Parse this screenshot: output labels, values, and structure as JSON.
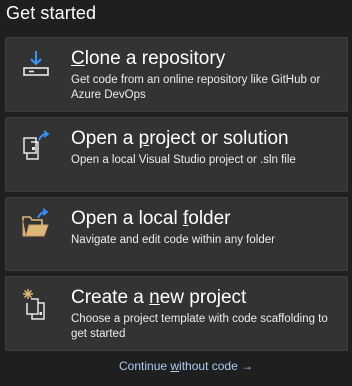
{
  "heading": "Get started",
  "cards": [
    {
      "icon": "clone-repository-icon",
      "title_pre": "",
      "title_key": "C",
      "title_post": "lone a repository",
      "description": "Get code from an online repository like GitHub or Azure DevOps"
    },
    {
      "icon": "open-project-icon",
      "title_pre": "Open a ",
      "title_key": "p",
      "title_post": "roject or solution",
      "description": "Open a local Visual Studio project or .sln file"
    },
    {
      "icon": "open-folder-icon",
      "title_pre": "Open a local ",
      "title_key": "f",
      "title_post": "older",
      "description": "Navigate and edit code within any folder"
    },
    {
      "icon": "new-project-icon",
      "title_pre": "Create a ",
      "title_key": "n",
      "title_post": "ew project",
      "description": "Choose a project template with code scaffolding to get started"
    }
  ],
  "continue_link": {
    "pre": "Continue ",
    "key": "w",
    "post": "ithout code",
    "arrow": "→"
  },
  "colors": {
    "background": "#1f1f1f",
    "card": "#333333",
    "link": "#a9cdf4",
    "accent_blue": "#3794ff",
    "folder_yellow": "#dcb67a"
  }
}
